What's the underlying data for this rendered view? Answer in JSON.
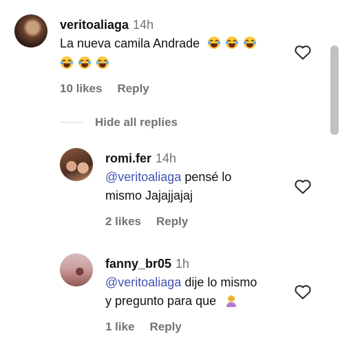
{
  "comments": [
    {
      "username": "veritoaliaga",
      "time": "14h",
      "text_line1": "La nueva camila Andrade",
      "likes": "10 likes",
      "reply": "Reply"
    }
  ],
  "hide_replies": "Hide all replies",
  "replies": [
    {
      "username": "romi.fer",
      "time": "14h",
      "mention": "@veritoaliaga",
      "text_line1_rest": " pensé lo",
      "text_line2": "mismo Jajajjajaj",
      "likes": "2 likes",
      "reply": "Reply"
    },
    {
      "username": "fanny_br05",
      "time": "1h",
      "mention": "@veritoaliaga",
      "text_line1_rest": " dije lo mismo",
      "text_line2": "y pregunto para que",
      "likes": "1 like",
      "reply": "Reply"
    }
  ],
  "icons": {
    "like": "heart-outline-icon",
    "laugh_emoji": "face-with-tears-of-joy",
    "shrug_emoji": "person-facepalming"
  }
}
